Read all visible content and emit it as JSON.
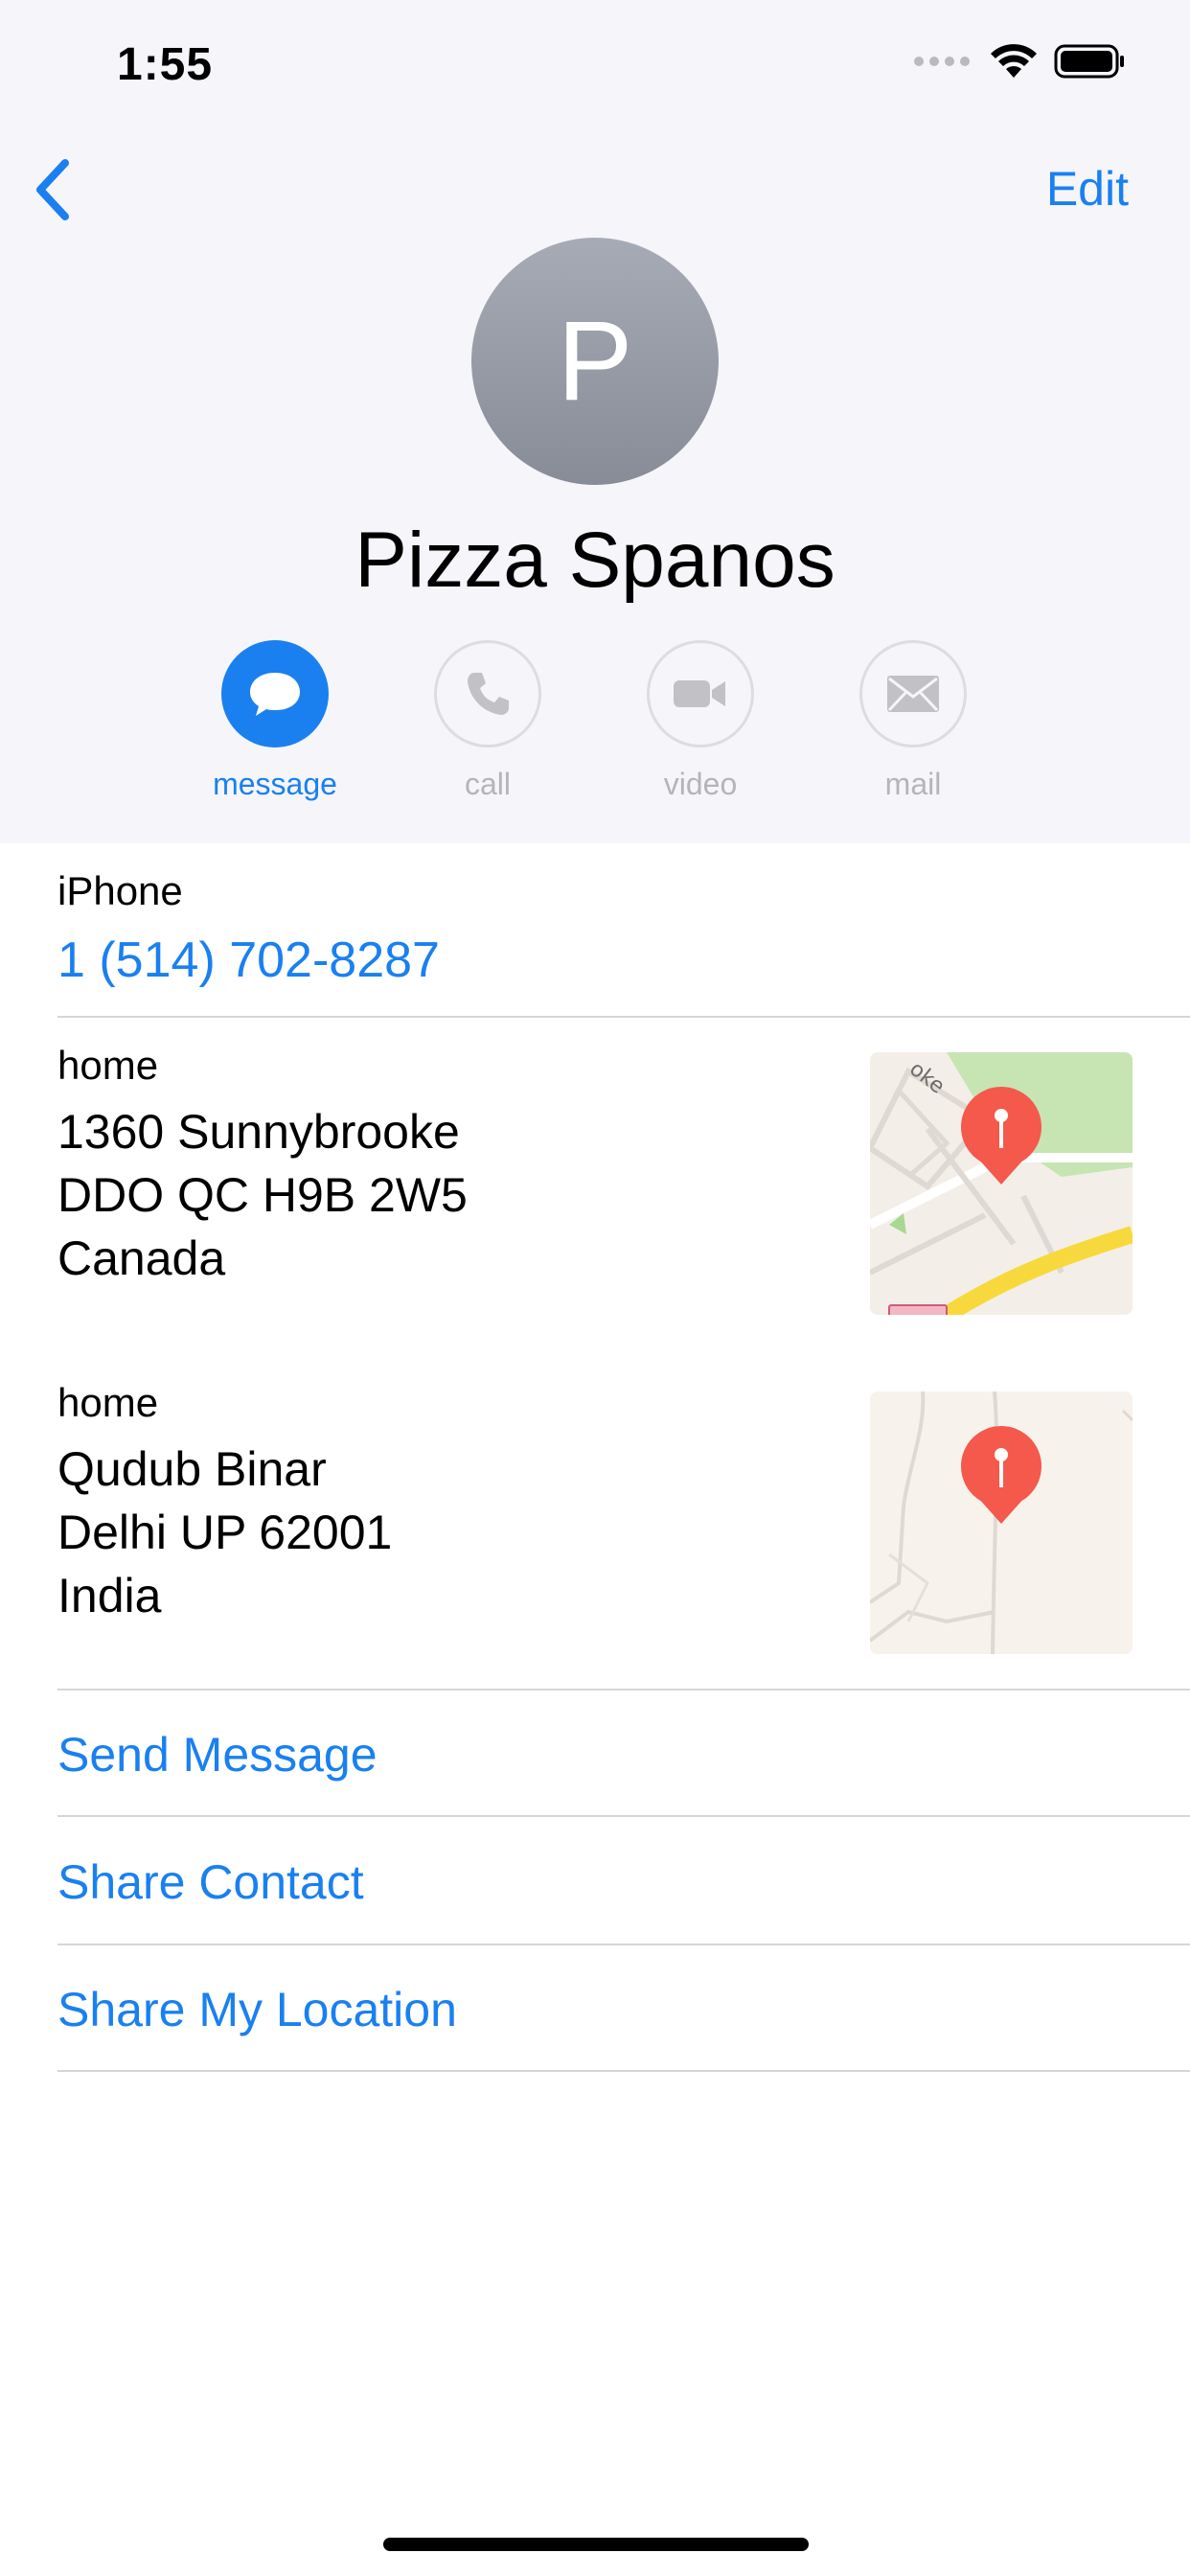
{
  "status_bar": {
    "time": "1:55",
    "icons": [
      "signal-dots-icon",
      "wifi-icon",
      "battery-icon"
    ]
  },
  "nav": {
    "back_icon": "chevron-left-icon",
    "edit_label": "Edit"
  },
  "contact": {
    "initial": "P",
    "name": "Pizza Spanos"
  },
  "actions": [
    {
      "label": "message",
      "icon": "message-bubble-icon",
      "enabled": true
    },
    {
      "label": "call",
      "icon": "phone-icon",
      "enabled": false
    },
    {
      "label": "video",
      "icon": "video-camera-icon",
      "enabled": false
    },
    {
      "label": "mail",
      "icon": "envelope-icon",
      "enabled": false
    }
  ],
  "phone": {
    "label": "iPhone",
    "number": "1 (514) 702-8287"
  },
  "addresses": [
    {
      "label": "home",
      "line1": "1360 Sunnybrooke",
      "line2": "DDO QC H9B 2W5",
      "line3": "Canada"
    },
    {
      "label": "home",
      "line1": "Qudub Binar",
      "line2": "Delhi UP 62001",
      "line3": "India"
    }
  ],
  "links": {
    "send_message": "Send Message",
    "share_contact": "Share Contact",
    "share_location": "Share My Location"
  },
  "colors": {
    "accent": "#1a80f0",
    "header_bg": "#f5f5fa",
    "pin": "#f4594b"
  }
}
